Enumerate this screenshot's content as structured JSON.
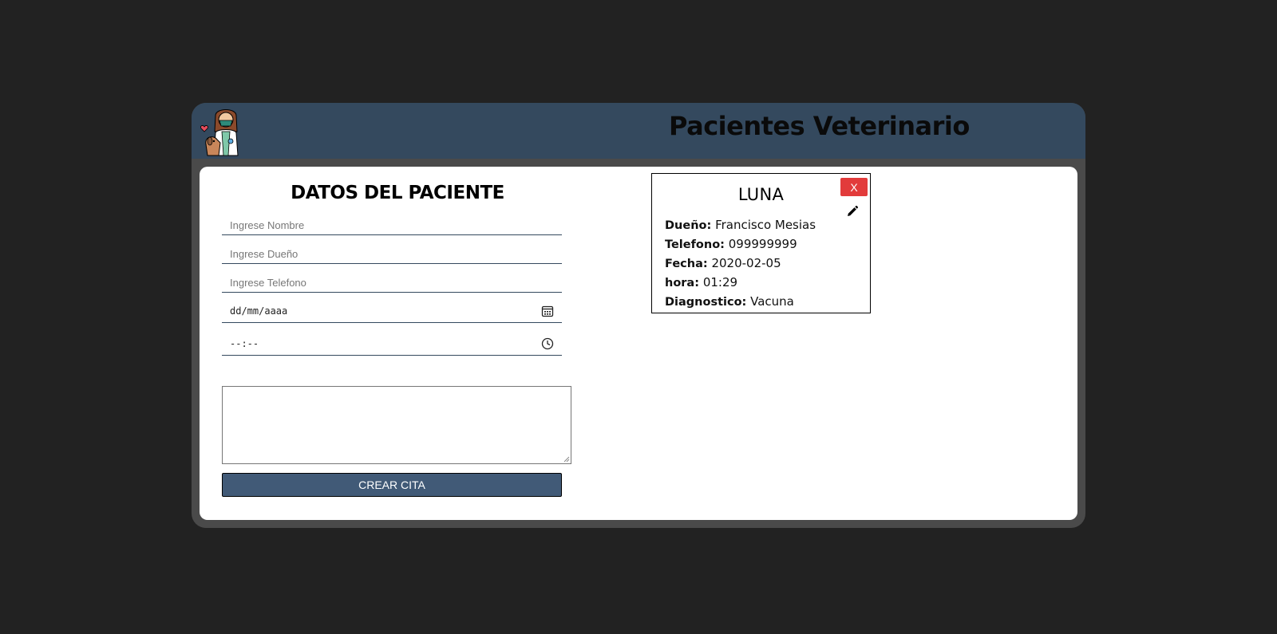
{
  "header": {
    "title": "Pacientes Veterinario",
    "logo_icon": "veterinarian-with-dog-icon"
  },
  "form": {
    "title": "DATOS DEL PACIENTE",
    "nombre_placeholder": "Ingrese Nombre",
    "dueno_placeholder": "Ingrese Dueño",
    "telefono_placeholder": "Ingrese Telefono",
    "fecha_placeholder": "dd/mm/aaaa",
    "hora_placeholder": "--:--",
    "diagnostico_value": "",
    "submit_label": "CREAR CITA"
  },
  "card": {
    "name": "LUNA",
    "delete_label": "X",
    "rows": [
      {
        "label": "Dueño:",
        "value": "Francisco Mesias"
      },
      {
        "label": "Telefono:",
        "value": "099999999"
      },
      {
        "label": "Fecha:",
        "value": "2020-02-05"
      },
      {
        "label": "hora:",
        "value": "01:29"
      },
      {
        "label": "Diagnostico:",
        "value": "Vacuna"
      }
    ]
  },
  "colors": {
    "page_bg": "#222222",
    "header_bg": "#34495e",
    "button_bg": "#415a77",
    "delete_bg": "#e23b3b"
  }
}
